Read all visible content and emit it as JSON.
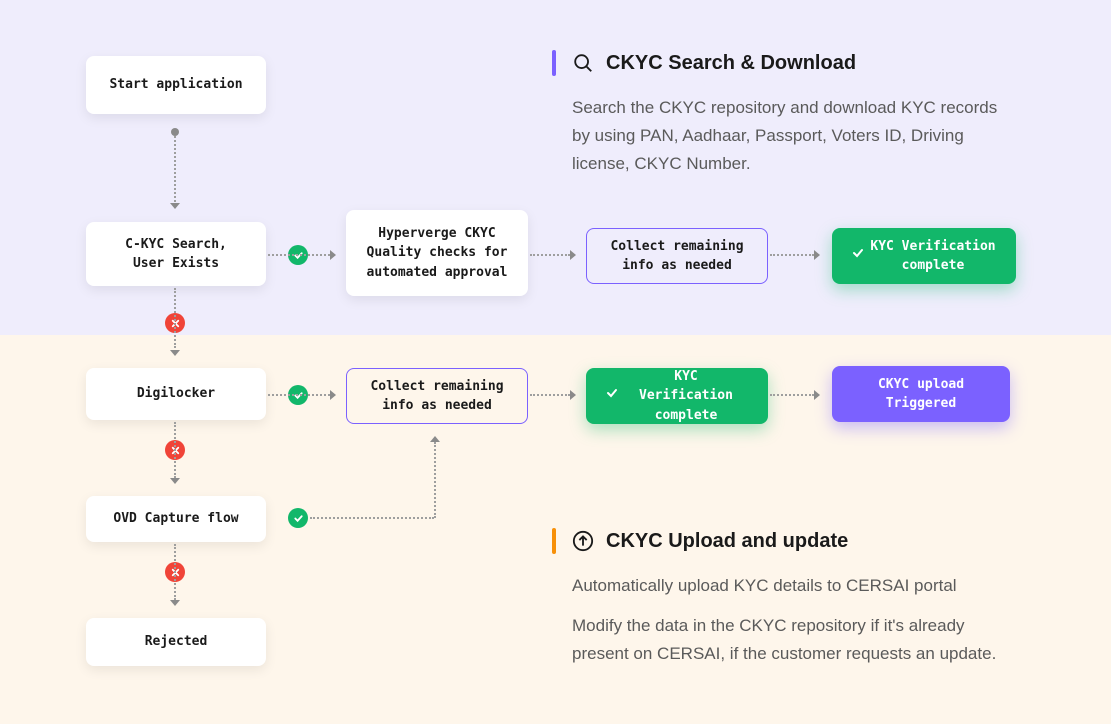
{
  "nodes": {
    "start": "Start application",
    "ckyc_search": "C-KYC Search,\nUser Exists",
    "quality": "Hyperverge CKYC\nQuality checks for\nautomated approval",
    "collect1": "Collect remaining\ninfo as needed",
    "verif1": "KYC Verification\ncomplete",
    "digilocker": "Digilocker",
    "collect2": "Collect remaining\ninfo as needed",
    "verif2": "KYC Verification\ncomplete",
    "upload": "CKYC upload\nTriggered",
    "ovd": "OVD Capture flow",
    "rejected": "Rejected"
  },
  "info1": {
    "title": "CKYC Search & Download",
    "body": "Search the CKYC repository and download KYC records by using PAN, Aadhaar,  Passport,  Voters ID, Driving license, CKYC Number."
  },
  "info2": {
    "title": "CKYC Upload and update",
    "body1": "Automatically upload KYC details to CERSAI portal",
    "body2": "Modify the data in the CKYC repository if it's already present on CERSAI, if the customer requests an update."
  }
}
